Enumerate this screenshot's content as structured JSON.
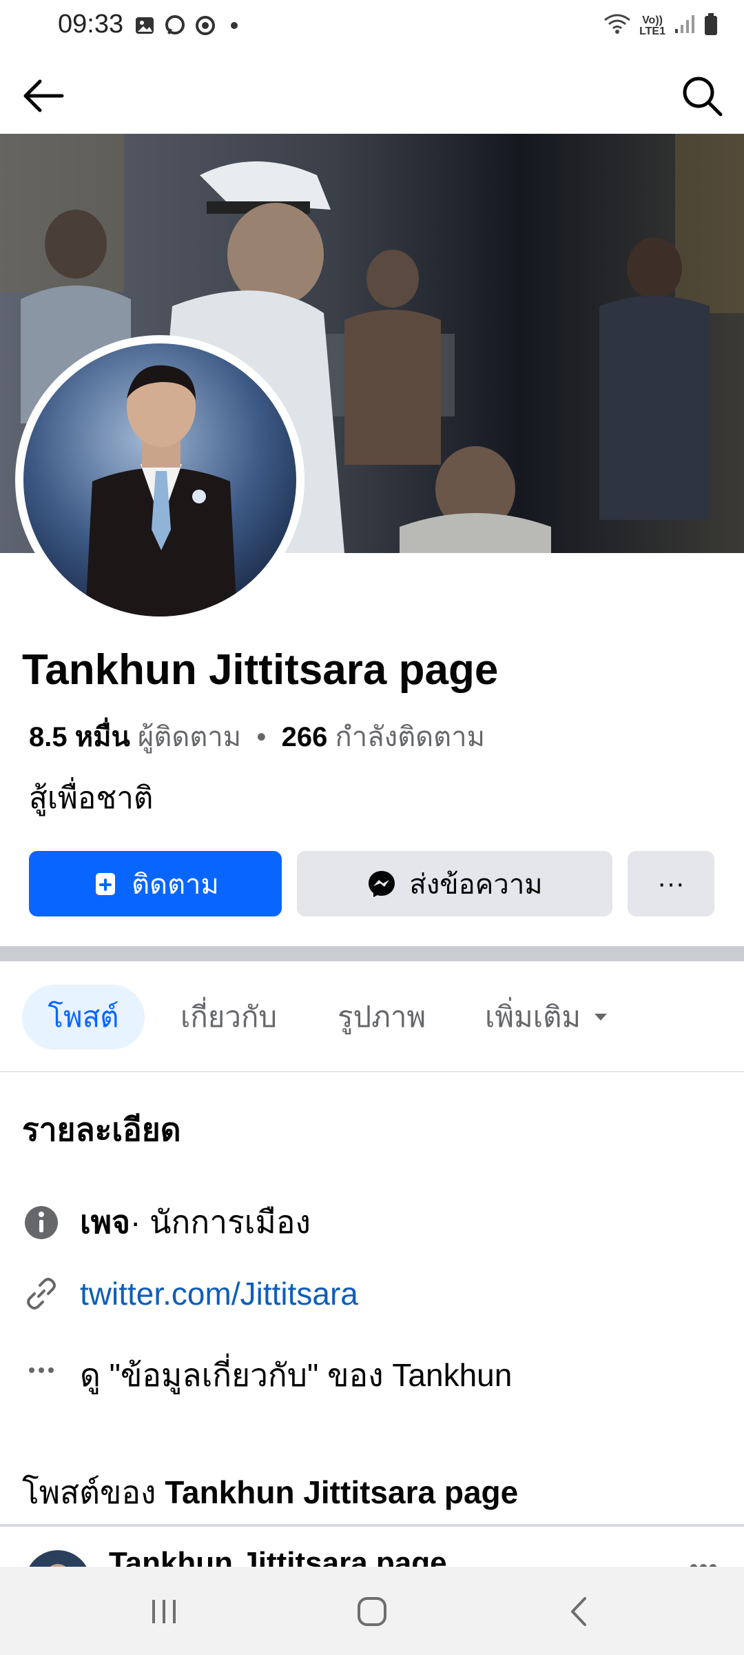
{
  "status_bar": {
    "time": "09:33",
    "icons": [
      "image-icon",
      "messenger-icon",
      "chrome-icon",
      "dot-icon"
    ],
    "volte_top": "Vo))",
    "volte_bottom": "LTE1"
  },
  "header": {
    "back_icon": "arrow-left-icon",
    "search_icon": "search-icon"
  },
  "profile": {
    "name": "Tankhun Jittitsara page",
    "followers_count": "8.5 หมื่น",
    "followers_label": "ผู้ติดตาม",
    "following_count": "266",
    "following_label": "กำลังติดตาม",
    "bio": "สู้เพื่อชาติ"
  },
  "actions": {
    "follow_label": "ติดตาม",
    "message_label": "ส่งข้อความ",
    "more_label": "···"
  },
  "tabs": [
    {
      "label": "โพสต์",
      "active": true
    },
    {
      "label": "เกี่ยวกับ",
      "active": false
    },
    {
      "label": "รูปภาพ",
      "active": false
    },
    {
      "label": "เพิ่มเติม",
      "active": false
    }
  ],
  "details": {
    "title": "รายละเอียด",
    "category_bold": "เพจ",
    "category_rest": " · นักการเมือง",
    "link": "twitter.com/Jittitsara",
    "see_about": "ดู \"ข้อมูลเกี่ยวกับ\" ของ Tankhun"
  },
  "posts": {
    "title_prefix": "โพสต์ของ ",
    "title_name": "Tankhun Jittitsara page",
    "first_post_author": "Tankhun Jittitsara page"
  },
  "colors": {
    "accent": "#0866ff",
    "link": "#0f5eb9",
    "tab_active_bg": "#e7f3ff",
    "button_grey": "#e4e6eb"
  }
}
